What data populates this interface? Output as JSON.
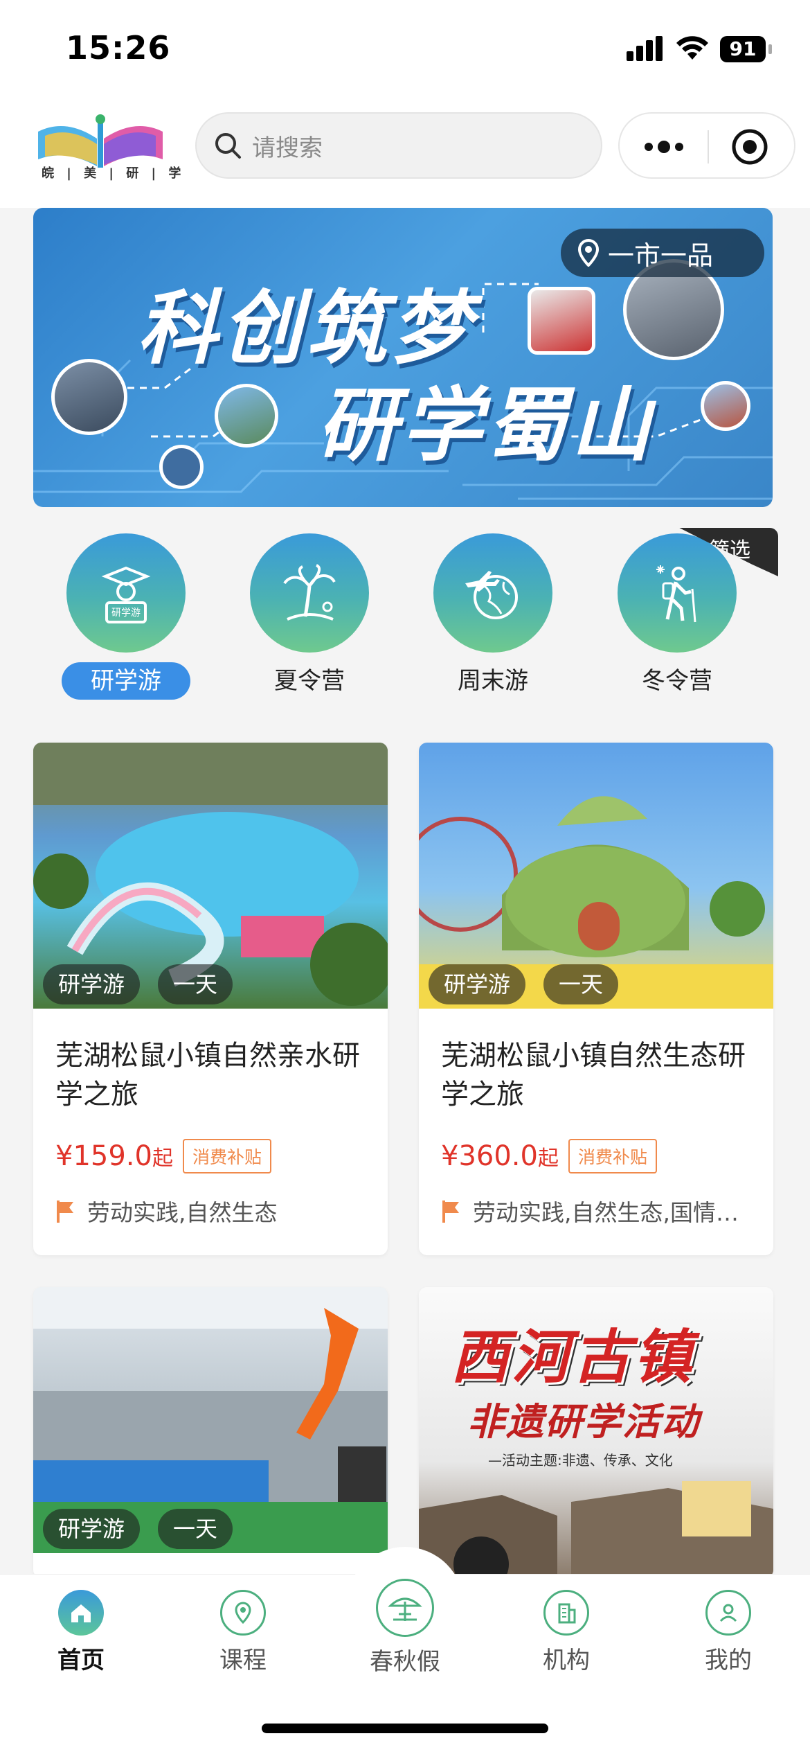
{
  "status_bar": {
    "time": "15:26",
    "battery": "91"
  },
  "header": {
    "logo_text": "皖 | 美 | 研 | 学",
    "search_placeholder": "请搜索"
  },
  "banner": {
    "title_line1": "科创筑梦",
    "title_line2": "研学蜀山",
    "location_badge": "一市一品"
  },
  "categories": [
    {
      "label": "研学游",
      "active": true
    },
    {
      "label": "夏令营",
      "active": false
    },
    {
      "label": "周末游",
      "active": false
    },
    {
      "label": "冬令营",
      "active": false
    }
  ],
  "filter_label": "筛选",
  "cards": [
    {
      "tags": [
        "研学游",
        "一天"
      ],
      "title": "芜湖松鼠小镇自然亲水研学之旅",
      "price": "¥159.0",
      "price_suffix": "起",
      "badge": "消费补贴",
      "theme": "劳动实践,自然生态"
    },
    {
      "tags": [
        "研学游",
        "一天"
      ],
      "title": "芜湖松鼠小镇自然生态研学之旅",
      "price": "¥360.0",
      "price_suffix": "起",
      "badge": "消费补贴",
      "theme": "劳动实践,自然生态,国情…"
    },
    {
      "tags": [
        "研学游",
        "一天"
      ]
    },
    {
      "poster_title": "西河古镇",
      "poster_subtitle": "非遗研学活动",
      "poster_note": "—活动主题:非遗、传承、文化"
    }
  ],
  "tabbar": [
    {
      "label": "首页",
      "icon": "home-icon",
      "active": true
    },
    {
      "label": "课程",
      "icon": "location-icon",
      "active": false
    },
    {
      "label": "春秋假",
      "icon": "beach-icon",
      "active": false
    },
    {
      "label": "机构",
      "icon": "building-icon",
      "active": false
    },
    {
      "label": "我的",
      "icon": "user-icon",
      "active": false
    }
  ],
  "colors": {
    "accent": "#3a8fe6",
    "price": "#e0342a",
    "tab_green": "#4caf7f"
  }
}
